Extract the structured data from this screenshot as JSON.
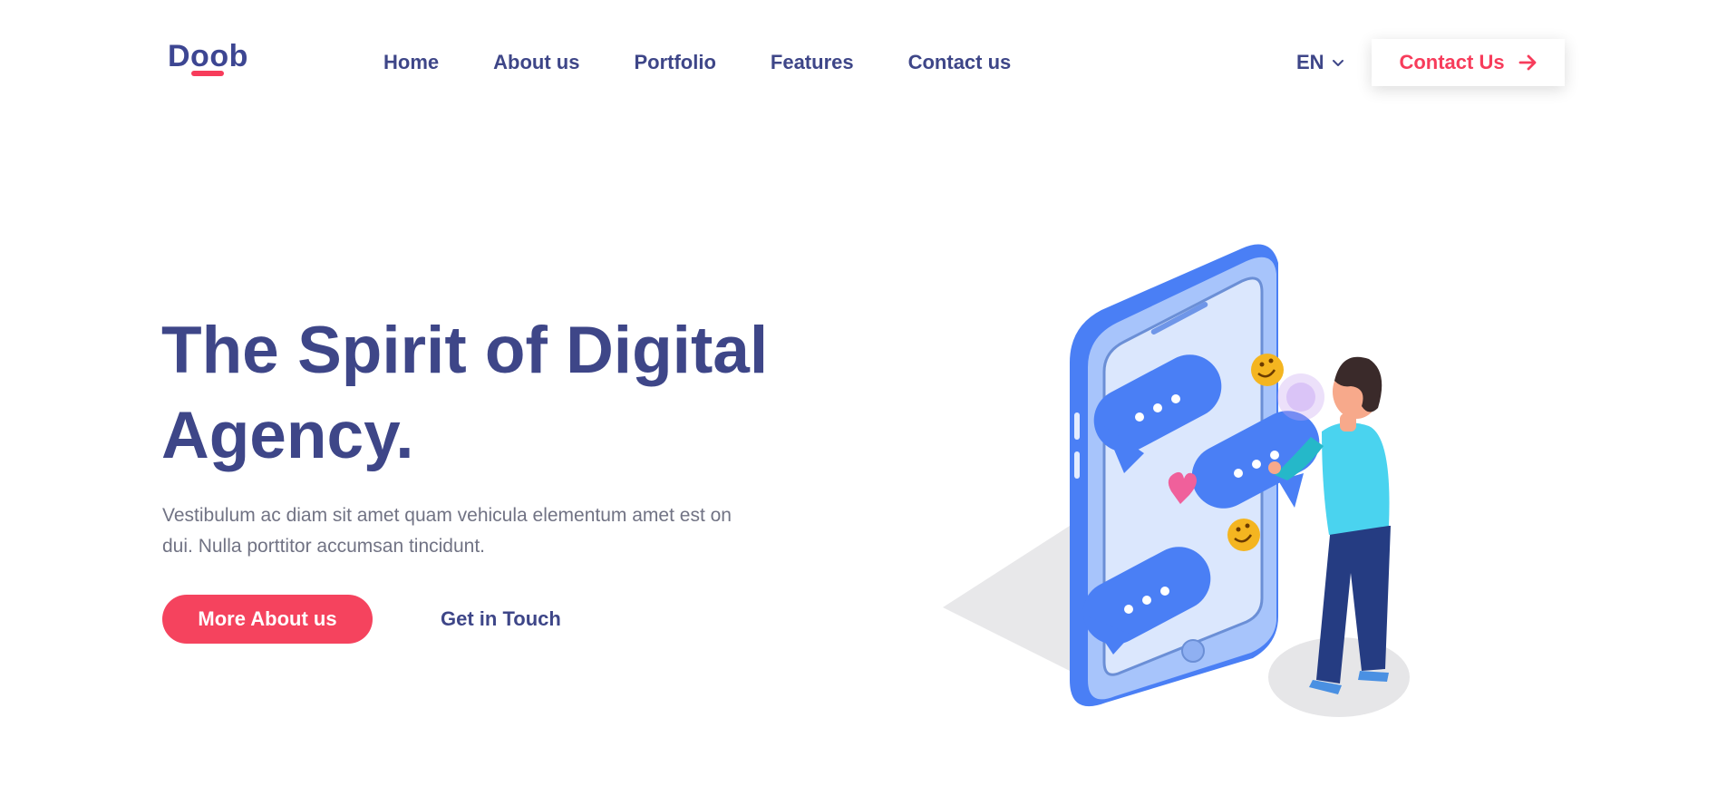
{
  "brand": {
    "logo_text": "Doob"
  },
  "nav": {
    "items": [
      {
        "label": "Home"
      },
      {
        "label": "About us"
      },
      {
        "label": "Portfolio"
      },
      {
        "label": "Features"
      },
      {
        "label": "Contact us"
      }
    ]
  },
  "language": {
    "selected": "EN",
    "icon": "chevron-down-icon"
  },
  "header_cta": {
    "label": "Contact Us",
    "icon": "arrow-right-icon"
  },
  "hero": {
    "title_line1": "The Spirit of Digital",
    "title_line2": "Agency.",
    "description_line1": "Vestibulum ac diam sit amet quam vehicula elementum amet est on",
    "description_line2": "dui. Nulla porttitor accumsan tincidunt.",
    "primary_button": "More About us",
    "secondary_link": "Get in Touch"
  },
  "colors": {
    "brand": "#3e4688",
    "accent": "#f5435e",
    "text_muted": "#717384",
    "phone_blue": "#4a80f5",
    "phone_light": "#a9c6fb"
  }
}
